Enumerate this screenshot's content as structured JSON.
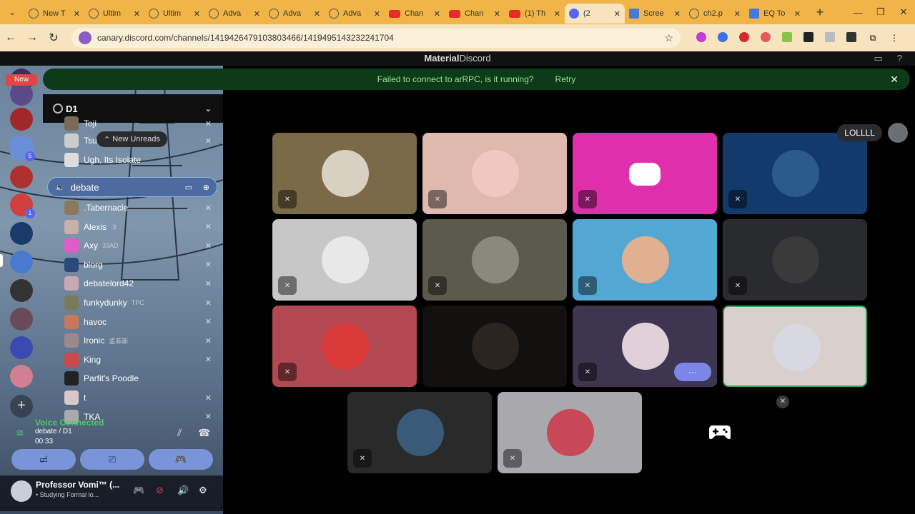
{
  "browser": {
    "tabs": [
      {
        "label": "New T",
        "icon": "globe"
      },
      {
        "label": "Ultim",
        "icon": "globe"
      },
      {
        "label": "Ultim",
        "icon": "globe"
      },
      {
        "label": "Adva",
        "icon": "globe"
      },
      {
        "label": "Adva",
        "icon": "globe"
      },
      {
        "label": "Adva",
        "icon": "globe"
      },
      {
        "label": "Chan",
        "icon": "youtube"
      },
      {
        "label": "Chan",
        "icon": "youtube"
      },
      {
        "label": "(1) Th",
        "icon": "youtube"
      },
      {
        "label": "(2",
        "icon": "discord",
        "active": true
      },
      {
        "label": "Scree",
        "icon": "doc"
      },
      {
        "label": "ch2.p",
        "icon": "globe"
      },
      {
        "label": "EQ To",
        "icon": "doc"
      }
    ],
    "url": "canary.discord.com/channels/1419426479103803466/1419495143232241704"
  },
  "app": {
    "title_bold": "Material",
    "title_rest": "Discord"
  },
  "notice": {
    "message": "Failed to connect to arRPC, is it running?",
    "retry": "Retry"
  },
  "rail": {
    "new_label": "New",
    "badge_5": "5",
    "badge_1": "1"
  },
  "server": {
    "name": "D1"
  },
  "channel_list": {
    "new_unreads": "New Unreads",
    "voice_channel": "debate",
    "members_above": [
      {
        "name": "Toji"
      },
      {
        "name": "Tsu"
      },
      {
        "name": "Ugh, Its Isolate"
      }
    ],
    "members": [
      {
        "name": ".Tabernacle",
        "status": ""
      },
      {
        "name": "Alexis",
        "status": ":3"
      },
      {
        "name": "Axy",
        "status": "33AD"
      },
      {
        "name": "blorg",
        "status": ""
      },
      {
        "name": "debatelord42",
        "status": ""
      },
      {
        "name": "funkydunky",
        "status": "TPC"
      },
      {
        "name": "havoc",
        "status": ""
      },
      {
        "name": "Ironic",
        "status": "孟菲斯"
      },
      {
        "name": "King",
        "status": ""
      },
      {
        "name": "Parfit's Poodle",
        "status": ""
      },
      {
        "name": "t",
        "status": ""
      },
      {
        "name": "TKA",
        "status": ""
      }
    ]
  },
  "voice": {
    "title": "Voice Connected",
    "channel": "debate / D1",
    "time": "00:33"
  },
  "user": {
    "name": "Professor Vomi™ (...",
    "status": "• Studying Formal lo..."
  },
  "stage": {
    "activity_user": "LOLLLL",
    "more_label": "···",
    "colors": {
      "tile1": "#7a6a48",
      "tile2": "#dfb8ae",
      "tile3": "#e02fac",
      "tile4": "#123a6b",
      "tile5": "#c7c7c7",
      "tile6": "#5c5a4c",
      "tile7": "#53a8d3",
      "tile8": "#2a2b2e",
      "tile9": "#b24852",
      "tile10": "#121110",
      "tile11": "#3e3550",
      "tile12": "#d9cfcd",
      "tile13": "#2a2a2a",
      "tile14": "#a9a8ad"
    }
  }
}
